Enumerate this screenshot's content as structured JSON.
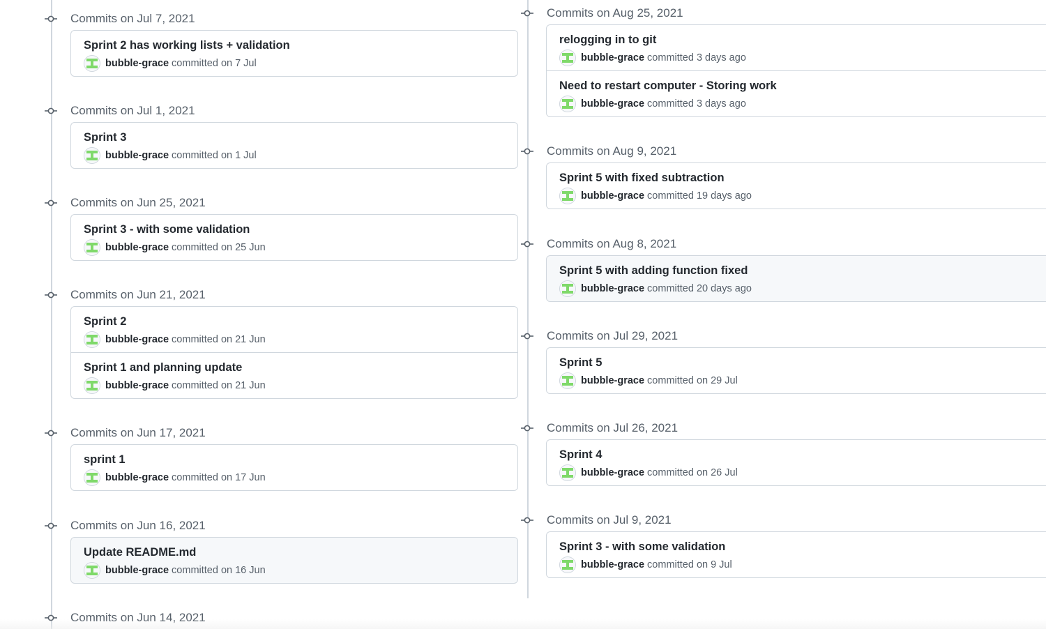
{
  "left_column": {
    "groups": [
      {
        "date_label": "Commits on Jul 7, 2021",
        "commits": [
          {
            "title": "Sprint 2 has working lists + validation",
            "author": "bubble-grace",
            "verb": "committed",
            "when": "on 7 Jul"
          }
        ]
      },
      {
        "date_label": "Commits on Jul 1, 2021",
        "commits": [
          {
            "title": "Sprint 3",
            "author": "bubble-grace",
            "verb": "committed",
            "when": "on 1 Jul"
          }
        ]
      },
      {
        "date_label": "Commits on Jun 25, 2021",
        "commits": [
          {
            "title": "Sprint 3 - with some validation",
            "author": "bubble-grace",
            "verb": "committed",
            "when": "on 25 Jun"
          }
        ]
      },
      {
        "date_label": "Commits on Jun 21, 2021",
        "commits": [
          {
            "title": "Sprint 2",
            "author": "bubble-grace",
            "verb": "committed",
            "when": "on 21 Jun"
          },
          {
            "title": "Sprint 1 and planning update",
            "author": "bubble-grace",
            "verb": "committed",
            "when": "on 21 Jun"
          }
        ]
      },
      {
        "date_label": "Commits on Jun 17, 2021",
        "commits": [
          {
            "title": "sprint 1",
            "author": "bubble-grace",
            "verb": "committed",
            "when": "on 17 Jun"
          }
        ]
      },
      {
        "date_label": "Commits on Jun 16, 2021",
        "commits": [
          {
            "title": "Update README.md",
            "author": "bubble-grace",
            "verb": "committed",
            "when": "on 16 Jun"
          }
        ]
      },
      {
        "date_label": "Commits on Jun 14, 2021",
        "commits": []
      }
    ]
  },
  "right_column": {
    "groups": [
      {
        "date_label": "Commits on Aug 25, 2021",
        "commits": [
          {
            "title": "relogging in to git",
            "author": "bubble-grace",
            "verb": "committed",
            "when": "3 days ago"
          },
          {
            "title": "Need to restart computer - Storing work",
            "author": "bubble-grace",
            "verb": "committed",
            "when": "3 days ago"
          }
        ]
      },
      {
        "date_label": "Commits on Aug 9, 2021",
        "commits": [
          {
            "title": "Sprint 5 with fixed subtraction",
            "author": "bubble-grace",
            "verb": "committed",
            "when": "19 days ago"
          }
        ]
      },
      {
        "date_label": "Commits on Aug 8, 2021",
        "commits": [
          {
            "title": "Sprint 5 with adding function fixed",
            "author": "bubble-grace",
            "verb": "committed",
            "when": "20 days ago"
          }
        ]
      },
      {
        "date_label": "Commits on Jul 29, 2021",
        "commits": [
          {
            "title": "Sprint 5",
            "author": "bubble-grace",
            "verb": "committed",
            "when": "on 29 Jul"
          }
        ]
      },
      {
        "date_label": "Commits on Jul 26, 2021",
        "commits": [
          {
            "title": "Sprint 4",
            "author": "bubble-grace",
            "verb": "committed",
            "when": "on 26 Jul"
          }
        ]
      },
      {
        "date_label": "Commits on Jul 9, 2021",
        "commits": [
          {
            "title": "Sprint 3 - with some validation",
            "author": "bubble-grace",
            "verb": "committed",
            "when": "on 9 Jul"
          }
        ]
      }
    ]
  },
  "icons": {
    "commit_node": "git-commit-icon",
    "avatar": "identicon-avatar"
  },
  "colors": {
    "timeline": "#d0d7de",
    "node": "#57606a",
    "avatar_green": "#7fd96a",
    "highlight_bg": "#f6f8fa",
    "border": "#d0d7de"
  }
}
